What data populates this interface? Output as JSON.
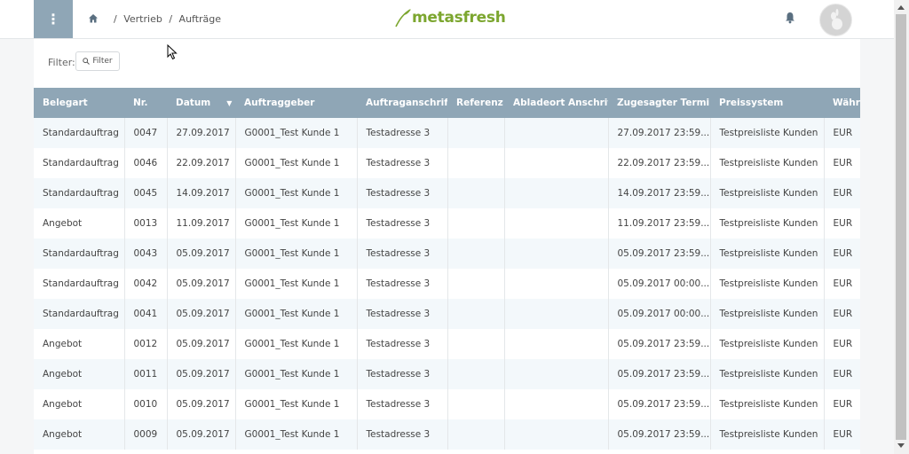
{
  "header": {
    "menu_icon": "vertical-dots-icon",
    "breadcrumb": [
      "/",
      "Vertrieb",
      "/",
      "Aufträge"
    ],
    "logo_text": "metasfresh"
  },
  "filter": {
    "label": "Filter:",
    "button_label": "Filter"
  },
  "table": {
    "columns": [
      "Belegart",
      "Nr.",
      "Datum",
      "Auftraggeber",
      "Auftraganschrift",
      "Referenz",
      "Abladeort Anschrift",
      "Zugesagter Termin",
      "Preissystem",
      "Währu"
    ],
    "rows": [
      [
        "Standardauftrag",
        "0047",
        "27.09.2017",
        "G0001_Test Kunde 1",
        "Testadresse 3",
        "",
        "",
        "27.09.2017 23:59...",
        "Testpreisliste Kunden",
        "EUR"
      ],
      [
        "Standardauftrag",
        "0046",
        "22.09.2017",
        "G0001_Test Kunde 1",
        "Testadresse 3",
        "",
        "",
        "22.09.2017 23:59...",
        "Testpreisliste Kunden",
        "EUR"
      ],
      [
        "Standardauftrag",
        "0045",
        "14.09.2017",
        "G0001_Test Kunde 1",
        "Testadresse 3",
        "",
        "",
        "14.09.2017 23:59...",
        "Testpreisliste Kunden",
        "EUR"
      ],
      [
        "Angebot",
        "0013",
        "11.09.2017",
        "G0001_Test Kunde 1",
        "Testadresse 3",
        "",
        "",
        "11.09.2017 23:59...",
        "Testpreisliste Kunden",
        "EUR"
      ],
      [
        "Standardauftrag",
        "0043",
        "05.09.2017",
        "G0001_Test Kunde 1",
        "Testadresse 3",
        "",
        "",
        "05.09.2017 23:59...",
        "Testpreisliste Kunden",
        "EUR"
      ],
      [
        "Standardauftrag",
        "0042",
        "05.09.2017",
        "G0001_Test Kunde 1",
        "Testadresse 3",
        "",
        "",
        "05.09.2017 00:00...",
        "Testpreisliste Kunden",
        "EUR"
      ],
      [
        "Standardauftrag",
        "0041",
        "05.09.2017",
        "G0001_Test Kunde 1",
        "Testadresse 3",
        "",
        "",
        "05.09.2017 00:00...",
        "Testpreisliste Kunden",
        "EUR"
      ],
      [
        "Angebot",
        "0012",
        "05.09.2017",
        "G0001_Test Kunde 1",
        "Testadresse 3",
        "",
        "",
        "05.09.2017 23:59...",
        "Testpreisliste Kunden",
        "EUR"
      ],
      [
        "Angebot",
        "0011",
        "05.09.2017",
        "G0001_Test Kunde 1",
        "Testadresse 3",
        "",
        "",
        "05.09.2017 23:59...",
        "Testpreisliste Kunden",
        "EUR"
      ],
      [
        "Angebot",
        "0010",
        "05.09.2017",
        "G0001_Test Kunde 1",
        "Testadresse 3",
        "",
        "",
        "05.09.2017 23:59...",
        "Testpreisliste Kunden",
        "EUR"
      ],
      [
        "Angebot",
        "0009",
        "05.09.2017",
        "G0001_Test Kunde 1",
        "Testadresse 3",
        "",
        "",
        "05.09.2017 23:59...",
        "Testpreisliste Kunden",
        "EUR"
      ]
    ]
  },
  "colors": {
    "header_accent": "#8fa6b6",
    "brand_green": "#7ca62f",
    "row_alt": "#f3f8fb"
  }
}
